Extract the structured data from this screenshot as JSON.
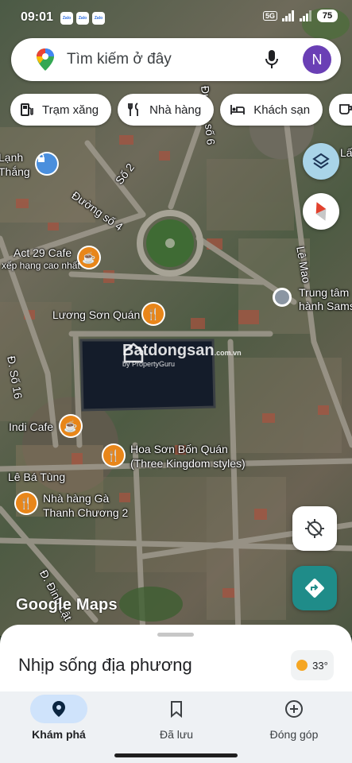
{
  "status_bar": {
    "time": "09:01",
    "notification_labels": [
      "Zalo",
      "Zalo",
      "Zalo"
    ],
    "network": "5G",
    "battery": "75"
  },
  "search": {
    "placeholder": "Tìm kiếm ở đây",
    "avatar_initial": "N",
    "icons": [
      "maps-pin-icon",
      "microphone-icon"
    ]
  },
  "chips": [
    {
      "label": "Trạm xăng",
      "icon": "gas-station-icon"
    },
    {
      "label": "Nhà hàng",
      "icon": "restaurant-icon"
    },
    {
      "label": "Khách sạn",
      "icon": "hotel-bed-icon"
    },
    {
      "label": "",
      "icon": "coffee-icon"
    }
  ],
  "map": {
    "places": [
      {
        "name": "Lạnh",
        "icon": "lock-icon"
      },
      {
        "name": "Thắng"
      },
      {
        "name": "Act 29 Cafe",
        "subtitle": "xếp hạng cao nhất",
        "icon": "cafe-icon"
      },
      {
        "name": "Lương Sơn Quán",
        "icon": "restaurant-icon"
      },
      {
        "name": "Trung tâm",
        "subtitle": "hành Sams",
        "icon": "place-icon"
      },
      {
        "name": "Indi Cafe",
        "icon": "cafe-icon"
      },
      {
        "name": "Hoa Sơn Bốn Quán",
        "subtitle": "(Three Kingdom styles)",
        "icon": "restaurant-icon"
      },
      {
        "name": "Nhà hàng Gà",
        "subtitle": "Thanh Chương 2",
        "icon": "restaurant-icon"
      }
    ],
    "streets": [
      "Số 2",
      "Đường số 4",
      "Đ. Số 16",
      "Đường số 6",
      "Lê Mao",
      "Lê Bá Tùng",
      "Đ. Đinh Lật",
      "Lấ"
    ],
    "watermark": {
      "brand": "Batdongsan",
      "domain": ".com.vn",
      "tagline": "by PropertyGuru"
    },
    "attribution": "Google Maps"
  },
  "controls": {
    "layers_icon": "layers-icon",
    "compass_icon": "compass-icon",
    "locate_icon": "location-disabled-icon",
    "directions_icon": "directions-icon"
  },
  "sheet": {
    "title": "Nhịp sống địa phương",
    "temperature": "33°",
    "weather_icon": "sunny-icon"
  },
  "nav": [
    {
      "label": "Khám phá",
      "icon": "explore-pin-icon",
      "active": true
    },
    {
      "label": "Đã lưu",
      "icon": "bookmark-icon",
      "active": false
    },
    {
      "label": "Đóng góp",
      "icon": "add-circle-icon",
      "active": false
    }
  ],
  "colors": {
    "accent": "#1a73e8",
    "avatar": "#6a3fb5",
    "pin_orange": "#e8861a",
    "directions": "#1f8c89",
    "layers_btn": "#a9d4e8",
    "nav_active": "#cfe3fb"
  }
}
